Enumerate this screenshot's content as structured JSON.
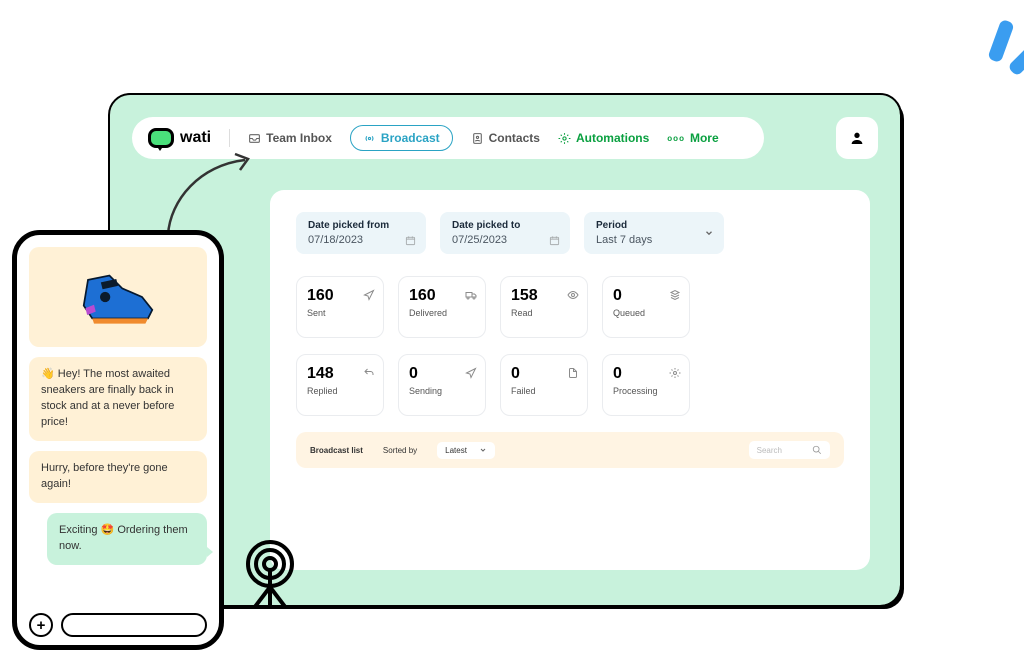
{
  "brand": "wati",
  "nav": {
    "team_inbox": "Team Inbox",
    "broadcast": "Broadcast",
    "contacts": "Contacts",
    "automations": "Automations",
    "more": "More"
  },
  "filters": {
    "from_label": "Date picked from",
    "from_value": "07/18/2023",
    "to_label": "Date picked to",
    "to_value": "07/25/2023",
    "period_label": "Period",
    "period_value": "Last 7 days"
  },
  "metrics": {
    "sent": {
      "value": "160",
      "label": "Sent"
    },
    "delivered": {
      "value": "160",
      "label": "Delivered"
    },
    "read": {
      "value": "158",
      "label": "Read"
    },
    "queued": {
      "value": "0",
      "label": "Queued"
    },
    "replied": {
      "value": "148",
      "label": "Replied"
    },
    "sending": {
      "value": "0",
      "label": "Sending"
    },
    "failed": {
      "value": "0",
      "label": "Failed"
    },
    "processing": {
      "value": "0",
      "label": "Processing"
    }
  },
  "list": {
    "title": "Broadcast list",
    "sort_label": "Sorted by",
    "sort_value": "Latest",
    "search_placeholder": "Search"
  },
  "chat": {
    "msg1": "👋 Hey! The most awaited sneakers are finally back in stock and at a never before price!",
    "msg2": "Hurry, before they're gone again!",
    "reply": "Exciting 🤩 Ordering them now."
  }
}
